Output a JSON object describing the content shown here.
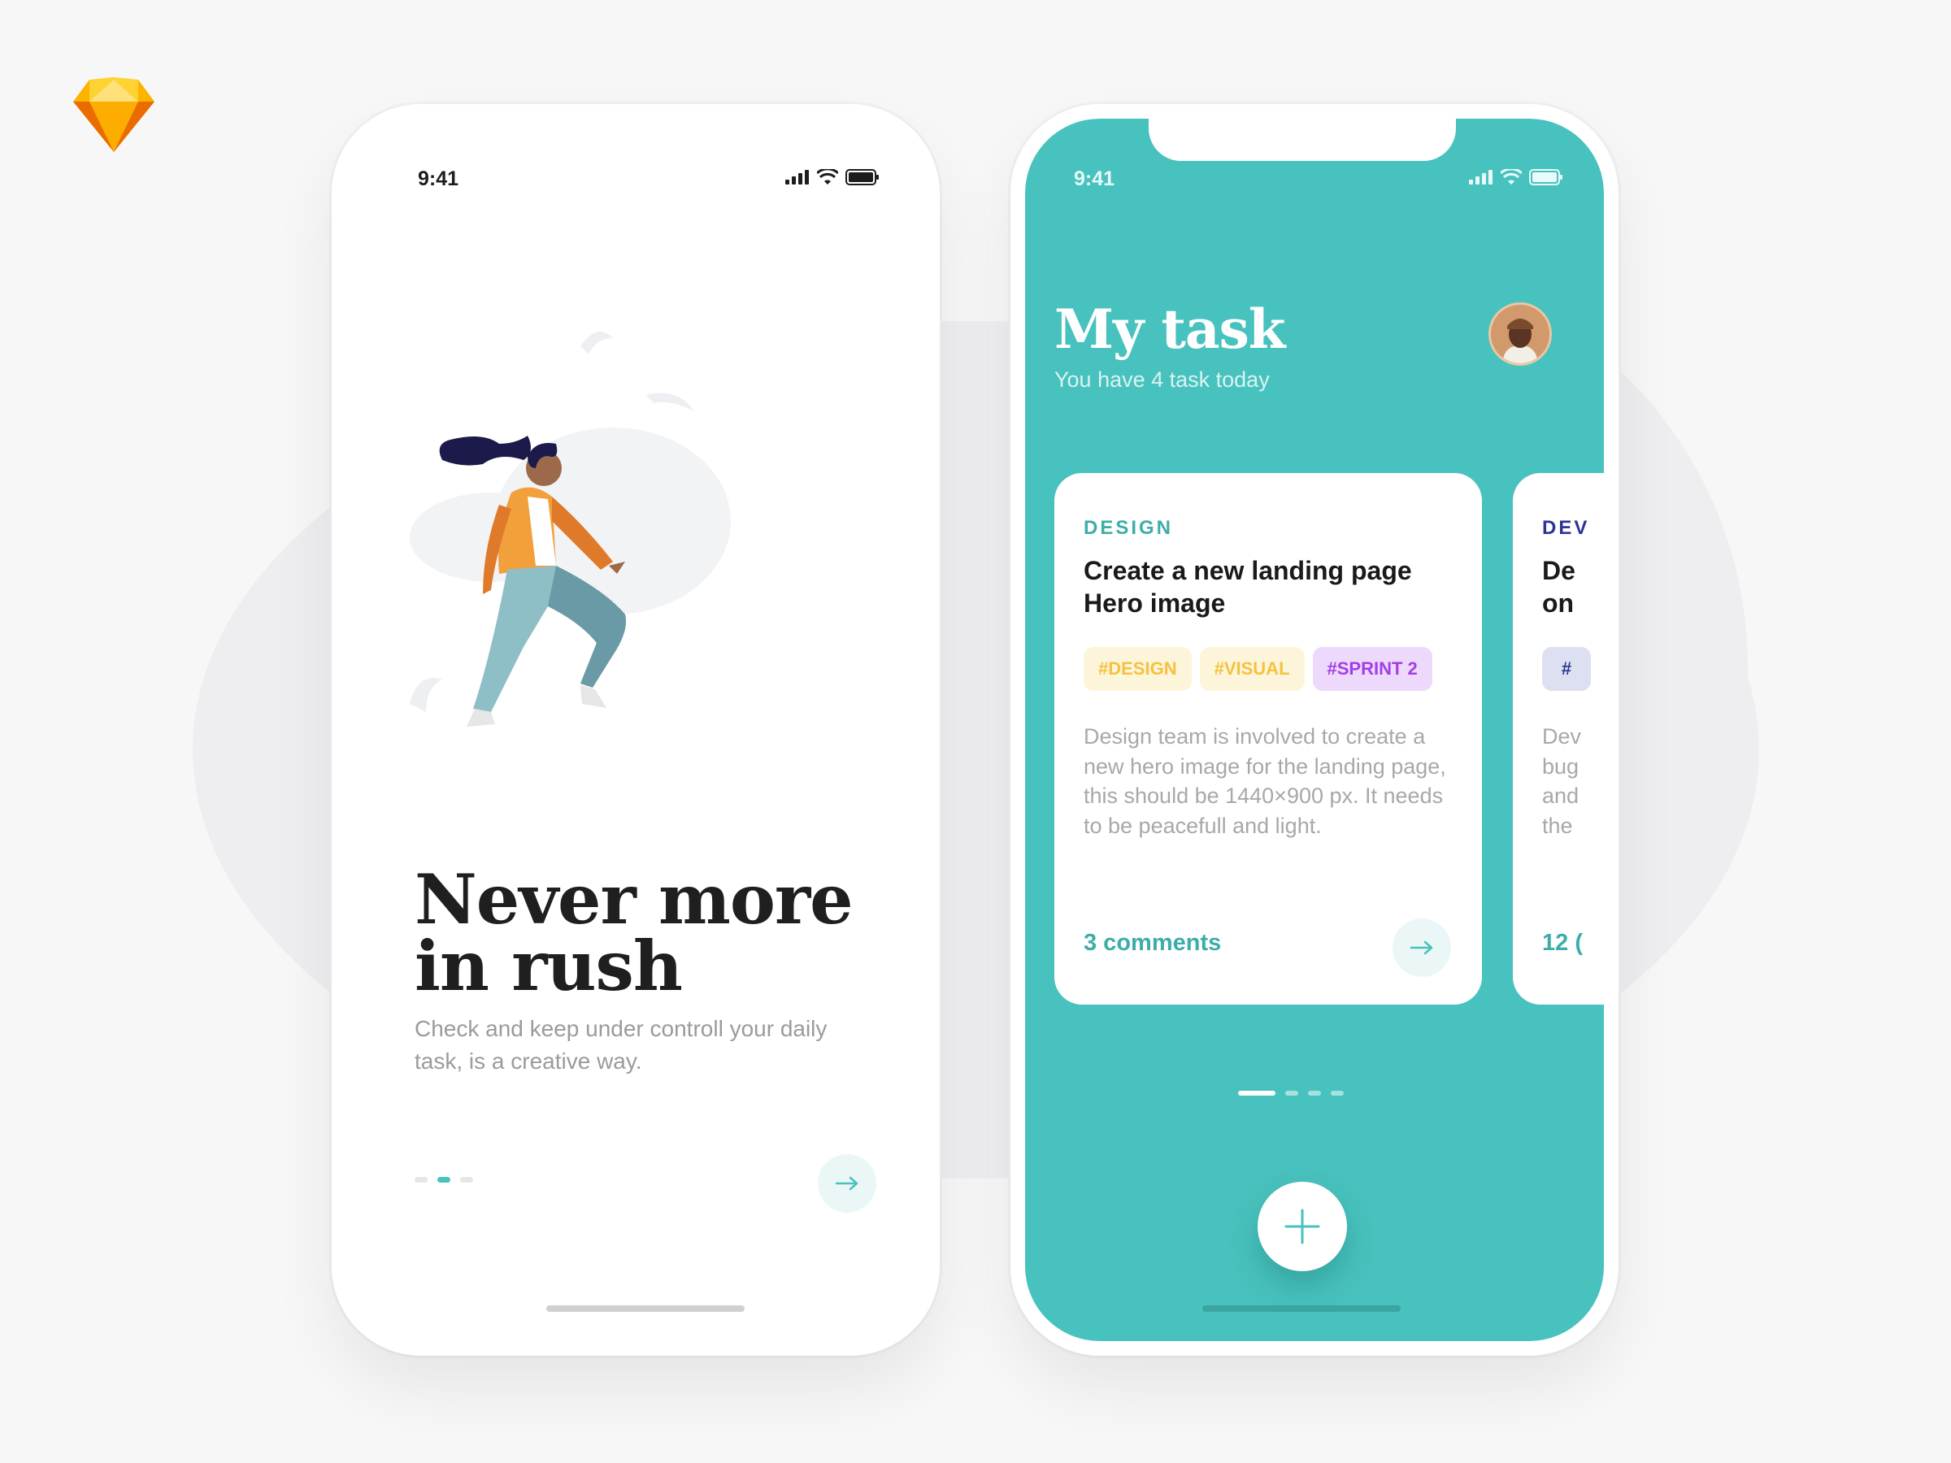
{
  "colors": {
    "accent": "#48c2be",
    "tag_yellow": "#f4c23e",
    "tag_purple": "#a43ee6",
    "dark_blue": "#2c3593"
  },
  "app_icon": "sketch-logo",
  "onboarding": {
    "time": "9:41",
    "headline": "Never more in rush",
    "subtext": "Check and keep under controll your daily task, is a creative way.",
    "page_dots": {
      "count": 3,
      "active_index": 1
    },
    "next_icon": "arrow-right-icon"
  },
  "tasks_screen": {
    "time": "9:41",
    "title": "My task",
    "subtitle": "You have 4 task today",
    "avatar_icon": "user-avatar",
    "cards": [
      {
        "category": "DESIGN",
        "title": "Create a new landing page Hero image",
        "tags": [
          "#DESIGN",
          "#VISUAL",
          "#SPRINT 2"
        ],
        "description": "Design team is involved to create a new hero image for the landing page, this should be 1440×900 px. It needs to be peacefull and light.",
        "comments": "3 comments"
      },
      {
        "category": "DEV",
        "title": "De on",
        "tag": "#",
        "description": "Dev bug and the",
        "comments": "12 ("
      }
    ],
    "page_dots": {
      "count": 4,
      "active_index": 0
    },
    "fab_icon": "plus-icon"
  }
}
